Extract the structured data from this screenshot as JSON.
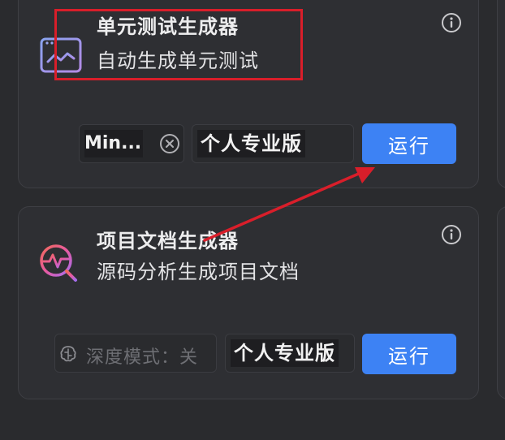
{
  "cards": [
    {
      "title": "单元测试生成器",
      "subtitle": "自动生成单元测试",
      "icon": "code-window-icon",
      "model_value": "Min...",
      "edition": "个人专业版",
      "run_label": "运行"
    },
    {
      "title": "项目文档生成器",
      "subtitle": "源码分析生成项目文档",
      "icon": "pulse-search-icon",
      "deep_mode_label": "深度模式：关",
      "edition": "个人专业版",
      "run_label": "运行"
    }
  ],
  "annotations": {
    "highlight_color": "#d91e2a",
    "arrow_color": "#d91e2a"
  },
  "colors": {
    "accent": "#3d82f4",
    "background": "#2a2b2e",
    "card": "#2e2f33"
  }
}
